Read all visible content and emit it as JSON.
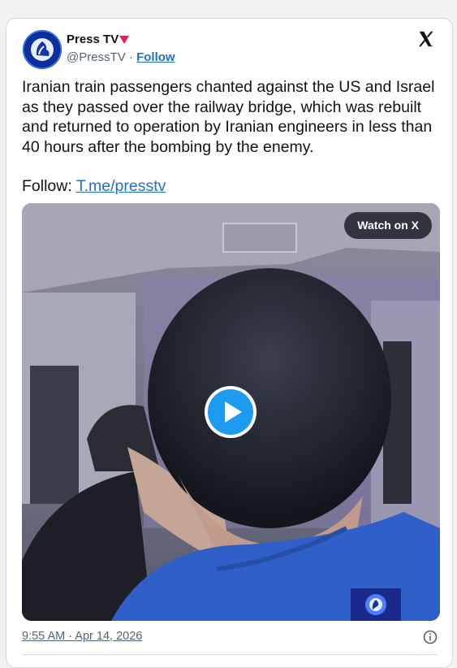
{
  "account": {
    "name": "Press TV",
    "handle": "@PressTV",
    "separator": "·",
    "follow_label": "Follow",
    "avatar_icon": "presstv-logo-icon",
    "badge_icon": "verified-triangle-icon"
  },
  "brand_logo": "x-logo-icon",
  "tweet": {
    "text": "Iranian train passengers chanted against the US and Israel as they passed over the railway bridge, which was rebuilt and returned to operation by Iranian engineers in less than 40 hours after the bombing by the enemy.",
    "follow_prefix": "Follow: ",
    "link_text": "T.me/presstv"
  },
  "media": {
    "type": "video",
    "watch_label": "Watch on X",
    "play_icon": "play-icon",
    "watermark_icon": "presstv-watermark-icon"
  },
  "footer": {
    "timestamp": "9:55 AM · Apr 14, 2026",
    "info_icon": "info-icon"
  },
  "colors": {
    "link": "#1d6ed8",
    "text": "#0f1419",
    "muted": "#536471",
    "play": "#1d9bf0",
    "badge": "#e0245e"
  }
}
